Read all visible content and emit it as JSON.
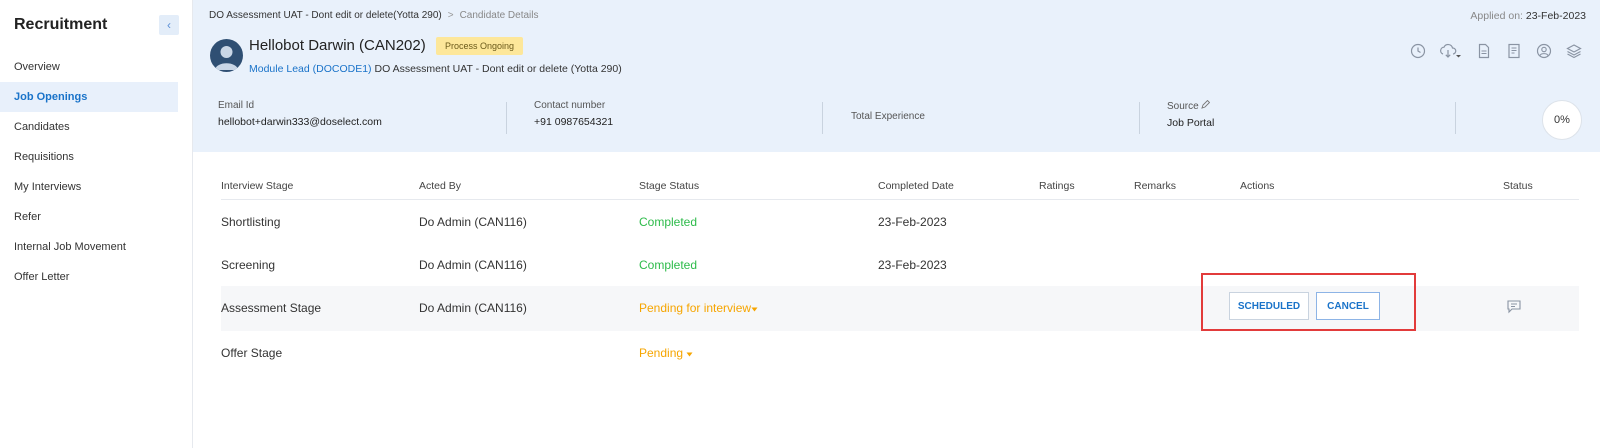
{
  "sidebar": {
    "title": "Recruitment",
    "collapse_glyph": "‹",
    "items": [
      {
        "label": "Overview"
      },
      {
        "label": "Job Openings",
        "active": true
      },
      {
        "label": "Candidates"
      },
      {
        "label": "Requisitions"
      },
      {
        "label": "My Interviews"
      },
      {
        "label": "Refer"
      },
      {
        "label": "Internal Job Movement"
      },
      {
        "label": "Offer Letter"
      }
    ]
  },
  "header": {
    "breadcrumb": [
      "DO Assessment UAT - Dont edit or delete(Yotta 290)",
      "Candidate Details"
    ],
    "breadcrumb_sep": ">",
    "applied_label": "Applied on:",
    "applied_date": "23-Feb-2023",
    "candidate_name": "Hellobot Darwin (CAN202)",
    "status_badge": "Process Ongoing",
    "role_link": "Module Lead (DOCODE1)",
    "role_rest": " DO Assessment UAT - Dont edit or delete (Yotta 290)",
    "icons": [
      "history-icon",
      "download-icon",
      "document-icon",
      "notes-icon",
      "user-icon",
      "layers-icon"
    ]
  },
  "info": {
    "email_label": "Email Id",
    "email_value": "hellobot+darwin333@doselect.com",
    "contact_label": "Contact number",
    "contact_value": "+91 0987654321",
    "experience_label": "Total Experience",
    "source_label": "Source",
    "source_value": "Job Portal",
    "progress": "0%"
  },
  "table": {
    "headers": [
      "Interview Stage",
      "Acted By",
      "Stage Status",
      "Completed Date",
      "Ratings",
      "Remarks",
      "Actions",
      "Status"
    ],
    "rows": [
      {
        "stage": "Shortlisting",
        "acted_by": "Do Admin (CAN116)",
        "status": "Completed",
        "date": "23-Feb-2023"
      },
      {
        "stage": "Screening",
        "acted_by": "Do Admin (CAN116)",
        "status": "Completed",
        "date": "23-Feb-2023"
      },
      {
        "stage": "Assessment Stage",
        "acted_by": "Do Admin (CAN116)",
        "status": "Pending for interview",
        "date": ""
      },
      {
        "stage": "Offer Stage",
        "acted_by": "",
        "status": "Pending",
        "date": ""
      }
    ],
    "actions": {
      "scheduled": "SCHEDULED",
      "cancel": "CANCEL"
    }
  },
  "colors": {
    "accent": "#1a73c9",
    "completed": "#2dbb4a",
    "pending": "#f6a500",
    "highlight_box": "#e23b3b"
  }
}
